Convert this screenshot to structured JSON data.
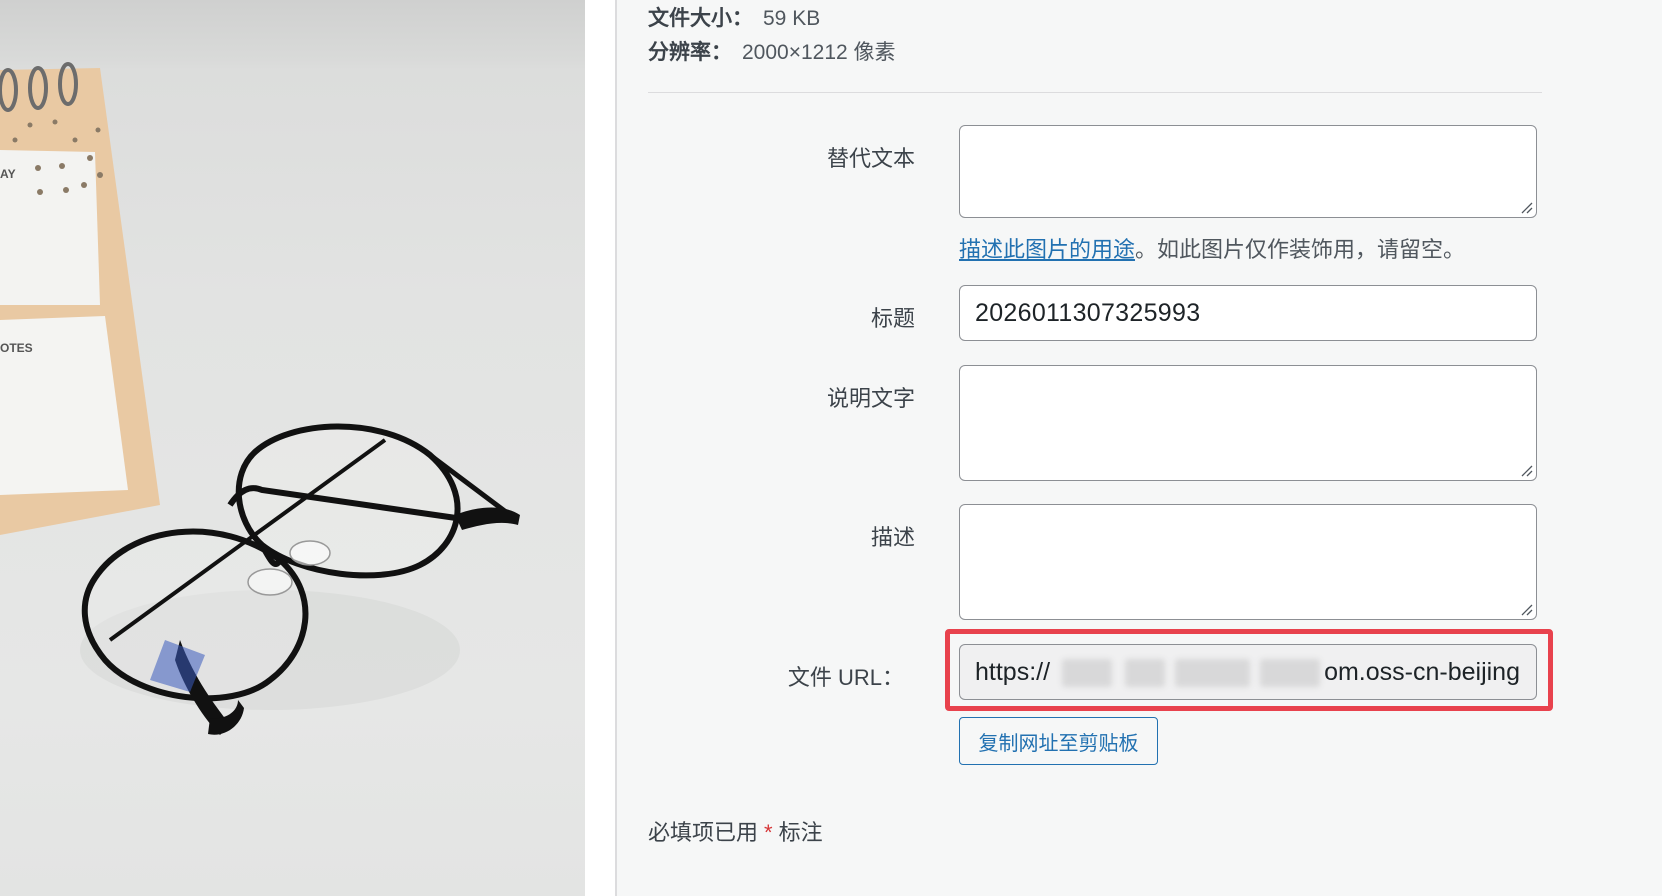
{
  "metadata": {
    "file_size_label": "文件大小：",
    "file_size_value": "59 KB",
    "resolution_label": "分辨率：",
    "resolution_value": "2000×1212 像素"
  },
  "fields": {
    "alt_text": {
      "label": "替代文本",
      "value": ""
    },
    "alt_hint": {
      "link": "描述此图片的用途",
      "rest": "。如此图片仅作装饰用，请留空。"
    },
    "title": {
      "label": "标题",
      "value": "2026011307325993"
    },
    "caption": {
      "label": "说明文字",
      "value": ""
    },
    "description": {
      "label": "描述",
      "value": ""
    },
    "file_url": {
      "label": "文件 URL：",
      "prefix": "https://",
      "visible_suffix": "om.oss-cn-beijing"
    }
  },
  "buttons": {
    "copy_url": "复制网址至剪贴板"
  },
  "required_note": {
    "before": "必填项已用",
    "star": "*",
    "after": "标注"
  },
  "colors": {
    "link": "#2271b1",
    "highlight": "#e8424d",
    "required": "#d63638",
    "panel_bg": "#f6f7f7"
  },
  "photo": {
    "subject": "glasses-and-desk-calendar"
  }
}
